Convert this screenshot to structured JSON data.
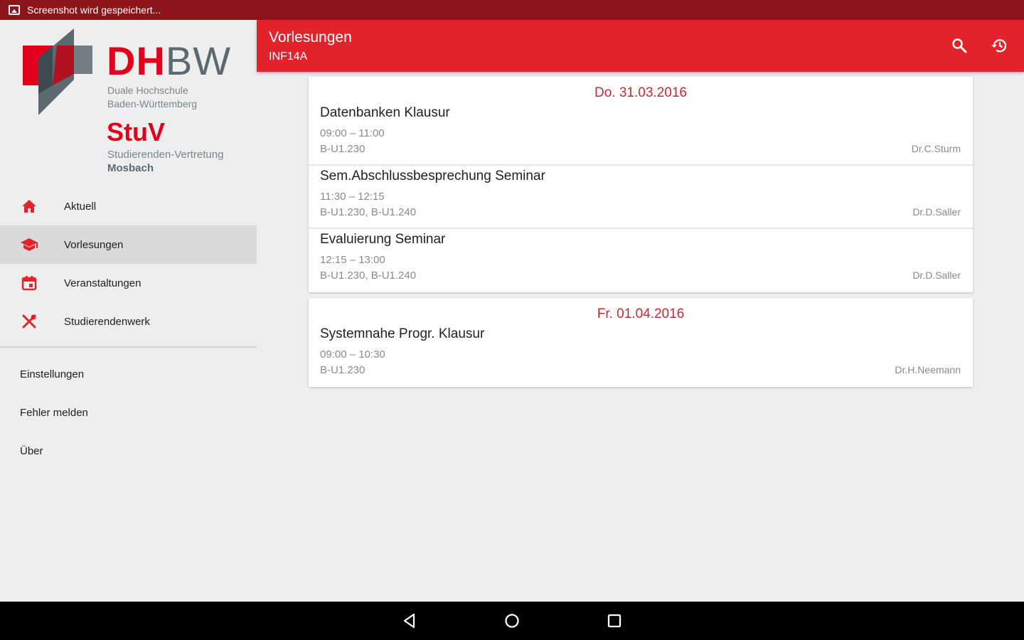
{
  "status_bar": {
    "text": "Screenshot wird gespeichert..."
  },
  "drawer": {
    "logo": {
      "dh": "DH",
      "bw": "BW",
      "sub_line1": "Duale Hochschule",
      "sub_line2": "Baden-Württemberg",
      "stuv": "StuV",
      "stuv_line1": "Studierenden-Vertretung",
      "stuv_line2": "Mosbach"
    },
    "items": [
      {
        "label": "Aktuell",
        "icon": "home-icon"
      },
      {
        "label": "Vorlesungen",
        "icon": "school-icon",
        "active": true
      },
      {
        "label": "Veranstaltungen",
        "icon": "calendar-icon"
      },
      {
        "label": "Studierendenwerk",
        "icon": "restaurant-icon"
      }
    ],
    "secondary_items": [
      {
        "label": "Einstellungen"
      },
      {
        "label": "Fehler melden"
      },
      {
        "label": "Über"
      }
    ]
  },
  "toolbar": {
    "title": "Vorlesungen",
    "subtitle": "INF14A",
    "actions": [
      "search-icon",
      "history-icon"
    ]
  },
  "days": [
    {
      "date": "Do. 31.03.2016",
      "lectures": [
        {
          "title": "Datenbanken Klausur",
          "time": "09:00 – 11:00",
          "room": "B-U1.230",
          "lecturer": "Dr.C.Sturm"
        },
        {
          "title": "Sem.Abschlussbesprechung Seminar",
          "time": "11:30 – 12:15",
          "room": "B-U1.230, B-U1.240",
          "lecturer": "Dr.D.Saller"
        },
        {
          "title": "Evaluierung Seminar",
          "time": "12:15 – 13:00",
          "room": "B-U1.230, B-U1.240",
          "lecturer": "Dr.D.Saller"
        }
      ]
    },
    {
      "date": "Fr. 01.04.2016",
      "lectures": [
        {
          "title": "Systemnahe Progr. Klausur",
          "time": "09:00 – 10:30",
          "room": "B-U1.230",
          "lecturer": "Dr.H.Neemann"
        }
      ]
    }
  ],
  "colors": {
    "primary": "#e2232b",
    "status_bar": "#8b1519",
    "date_text": "#d0262c",
    "logo_red": "#e2001a",
    "logo_grey": "#5d6970"
  },
  "system_nav": [
    "back-icon",
    "home-circle-icon",
    "recents-icon"
  ]
}
